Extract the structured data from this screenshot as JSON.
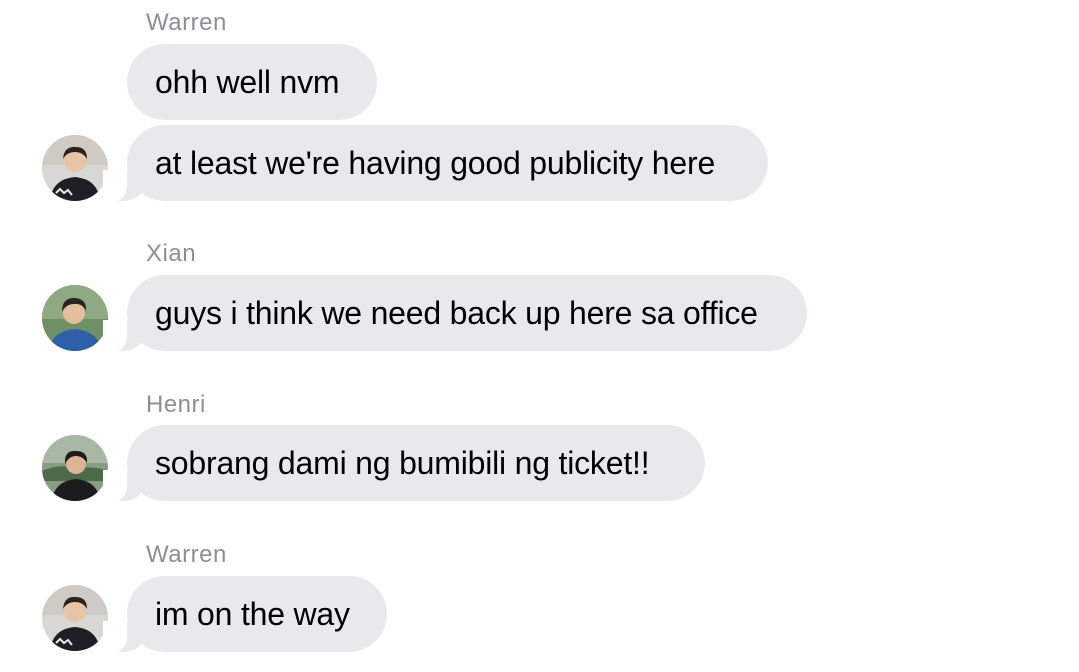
{
  "messages": [
    {
      "sender": "Warren",
      "text": "ohh well nvm",
      "avatar": null
    },
    {
      "sender": null,
      "text": "at least we're having good publicity here",
      "avatar": "warren-avatar"
    },
    {
      "sender": "Xian",
      "text": "guys i think we need back up here sa office",
      "avatar": "xian-avatar"
    },
    {
      "sender": "Henri",
      "text": "sobrang dami ng bumibili ng ticket!!",
      "avatar": "henri-avatar"
    },
    {
      "sender": "Warren",
      "text": "im on the way",
      "avatar": "warren-avatar"
    }
  ],
  "colors": {
    "bubble": "#e9e9eb",
    "sender_name": "#8e8e93",
    "text": "#000000"
  }
}
